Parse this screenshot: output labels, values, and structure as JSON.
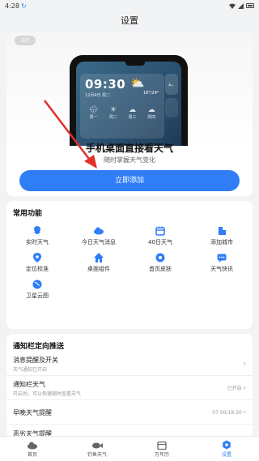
{
  "status_bar": {
    "time": "4:28",
    "sync_icon": "sync-icon"
  },
  "header": {
    "title": "设置"
  },
  "promo": {
    "page_indicator": "3/7",
    "title": "手机桌面直接看天气",
    "subtitle": "随时掌握天气变化",
    "button_label": "立即添加",
    "widget": {
      "time": "09:30",
      "date": "12月4日 周二",
      "temp": "18°/24°",
      "forecast": [
        {
          "day": "周一",
          "icon": "rain"
        },
        {
          "day": "周二",
          "icon": "sun"
        },
        {
          "day": "周三",
          "icon": "cloud"
        },
        {
          "day": "周四",
          "icon": "cloud"
        }
      ]
    }
  },
  "common_functions": {
    "title": "常用功能",
    "items": [
      {
        "label": "实时天气",
        "icon": "weather-icon",
        "color": "#2f7ef8"
      },
      {
        "label": "今日天气消息",
        "icon": "cloud-icon",
        "color": "#2f7ef8"
      },
      {
        "label": "40日天气",
        "icon": "calendar-icon",
        "color": "#2f7ef8"
      },
      {
        "label": "添加城市",
        "icon": "building-icon",
        "color": "#2f7ef8"
      },
      {
        "label": "定位校准",
        "icon": "location-icon",
        "color": "#2f7ef8"
      },
      {
        "label": "桌面组件",
        "icon": "home-icon",
        "color": "#2f7ef8"
      },
      {
        "label": "首页皮肤",
        "icon": "skin-icon",
        "color": "#2f7ef8"
      },
      {
        "label": "天气快讯",
        "icon": "message-icon",
        "color": "#2f7ef8"
      },
      {
        "label": "卫星云图",
        "icon": "globe-icon",
        "color": "#2f7ef8"
      }
    ]
  },
  "notifications": {
    "title": "通知栏定向推送",
    "rows": [
      {
        "title": "消息提醒及开关",
        "subtitle": "天气通知已开启",
        "value": ""
      },
      {
        "title": "通知栏天气",
        "subtitle": "开启后，可以快速随时查看天气",
        "value": "已开启"
      },
      {
        "title": "早晚天气提醒",
        "subtitle": "",
        "value": "07:00/18:30"
      },
      {
        "title": "恶劣天气提醒",
        "subtitle": "",
        "value": ""
      }
    ]
  },
  "bottom_nav": {
    "items": [
      {
        "label": "首页",
        "icon": "home-nav-icon",
        "active": false
      },
      {
        "label": "钓鱼天气",
        "icon": "fish-icon",
        "active": false
      },
      {
        "label": "万年历",
        "icon": "calendar-nav-icon",
        "active": false
      },
      {
        "label": "设置",
        "icon": "settings-icon",
        "active": true
      }
    ]
  },
  "colors": {
    "accent": "#2f7ef8",
    "background": "#f2f3f5",
    "annotation_arrow": "#e0302a"
  }
}
